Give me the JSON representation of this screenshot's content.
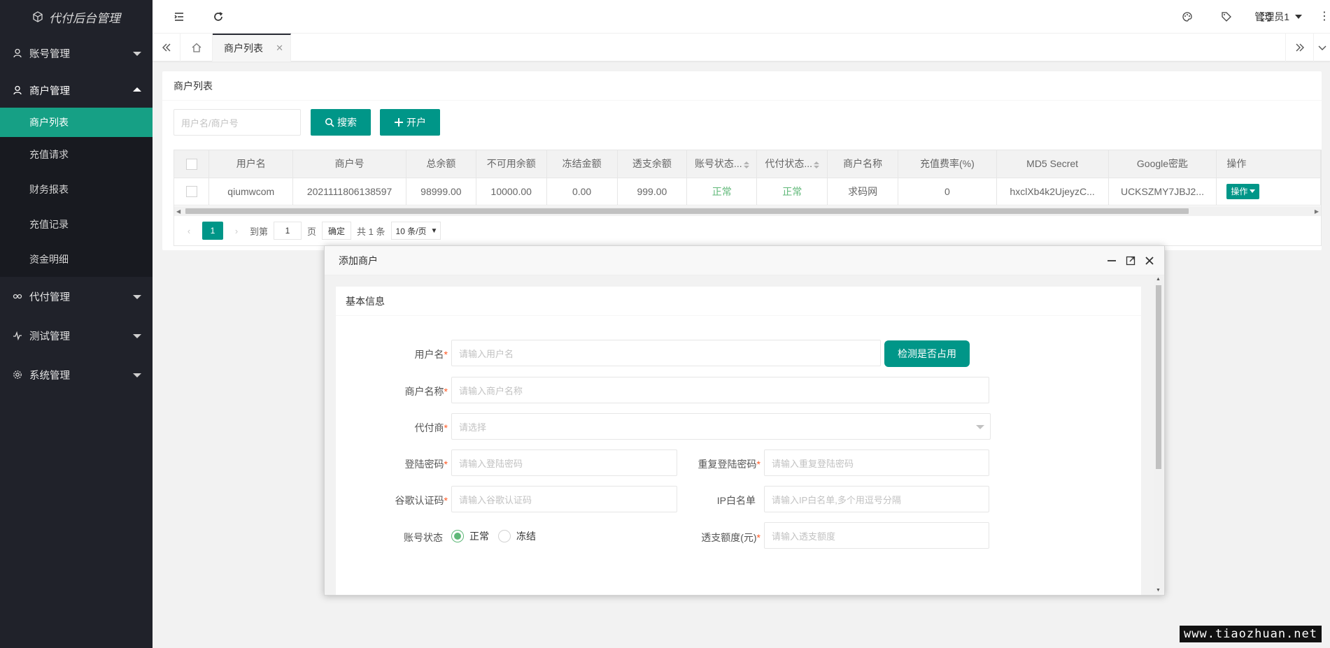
{
  "app": {
    "title": "代付后台管理"
  },
  "sidebar": {
    "groups": [
      {
        "label": "账号管理",
        "icon": "user-icon",
        "open": false
      },
      {
        "label": "商户管理",
        "icon": "user-icon",
        "open": true,
        "items": [
          "商户列表",
          "充值请求",
          "财务报表",
          "充值记录",
          "资金明细"
        ],
        "active": "商户列表"
      },
      {
        "label": "代付管理",
        "icon": "link-icon",
        "open": false
      },
      {
        "label": "测试管理",
        "icon": "pulse-icon",
        "open": false
      },
      {
        "label": "系统管理",
        "icon": "gear-icon",
        "open": false
      }
    ]
  },
  "header": {
    "admin": "管理员1"
  },
  "tabs": {
    "active": "商户列表"
  },
  "page": {
    "title": "商户列表",
    "search_placeholder": "用户名/商户号",
    "search_btn": "搜索",
    "open_btn": "开户"
  },
  "table": {
    "columns": [
      "用户名",
      "商户号",
      "总余额",
      "不可用余额",
      "冻结金额",
      "透支余额",
      "账号状态...",
      "代付状态...",
      "商户名称",
      "充值费率(%)",
      "MD5 Secret",
      "Google密匙",
      "操作"
    ],
    "rows": [
      {
        "username": "qiumwcom",
        "merchant_no": "2021111806138597",
        "total": "98999.00",
        "unavailable": "10000.00",
        "frozen": "0.00",
        "overdraft": "999.00",
        "account_status": "正常",
        "payout_status": "正常",
        "merchant_name": "求码网",
        "fee_rate": "0",
        "md5_secret": "hxclXb4k2UjeyzC...",
        "google_key": "UCKSZMY7JBJ2...",
        "op": "操作"
      }
    ]
  },
  "pager": {
    "current": "1",
    "goto_label": "到第",
    "goto_value": "1",
    "page_unit": "页",
    "confirm": "确定",
    "total": "共 1 条",
    "page_size": "10 条/页"
  },
  "modal": {
    "title": "添加商户",
    "section": "基本信息",
    "fields": {
      "username": {
        "label": "用户名",
        "placeholder": "请输入用户名"
      },
      "check_btn": "检测是否占用",
      "merchant_name": {
        "label": "商户名称",
        "placeholder": "请输入商户名称"
      },
      "agent": {
        "label": "代付商",
        "placeholder": "请选择"
      },
      "login_pwd": {
        "label": "登陆密码",
        "placeholder": "请输入登陆密码"
      },
      "repeat_pwd": {
        "label": "重复登陆密码",
        "placeholder": "请输入重复登陆密码"
      },
      "google_code": {
        "label": "谷歌认证码",
        "placeholder": "请输入谷歌认证码"
      },
      "ip_whitelist": {
        "label": "IP白名单",
        "placeholder": "请输入IP白名单,多个用逗号分隔"
      },
      "account_status": {
        "label": "账号状态",
        "options": [
          "正常",
          "冻结"
        ],
        "selected": "正常"
      },
      "overdraft": {
        "label": "透支额度(元)",
        "placeholder": "请输入透支额度"
      }
    }
  },
  "watermark": "www.tiaozhuan.net",
  "colors": {
    "accent": "#009688",
    "sidebar_bg": "#20222a",
    "active_item": "#16a085",
    "status_ok": "#5fb878"
  }
}
